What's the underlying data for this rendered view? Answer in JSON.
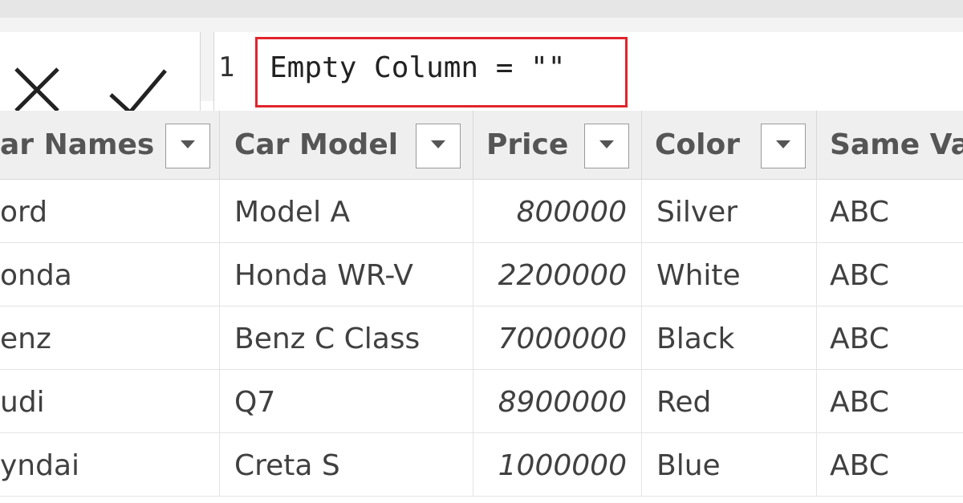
{
  "formula": {
    "line_number": "1",
    "expression": "Empty Column = \"\"",
    "highlight_color": "#e0252b"
  },
  "icons": {
    "cancel": "close-icon",
    "commit": "checkmark-icon",
    "filter": "dropdown-arrow-icon"
  },
  "table": {
    "columns": [
      "ar Names",
      "Car Model",
      "Price",
      "Color",
      "Same Va"
    ],
    "rows": [
      [
        "ord",
        "Model A",
        "800000",
        "Silver",
        "ABC"
      ],
      [
        "onda",
        "Honda WR-V",
        "2200000",
        "White",
        "ABC"
      ],
      [
        "enz",
        "Benz C Class",
        "7000000",
        "Black",
        "ABC"
      ],
      [
        "udi",
        "Q7",
        "8900000",
        "Red",
        "ABC"
      ],
      [
        "yndai",
        "Creta S",
        "1000000",
        "Blue",
        "ABC"
      ]
    ]
  }
}
